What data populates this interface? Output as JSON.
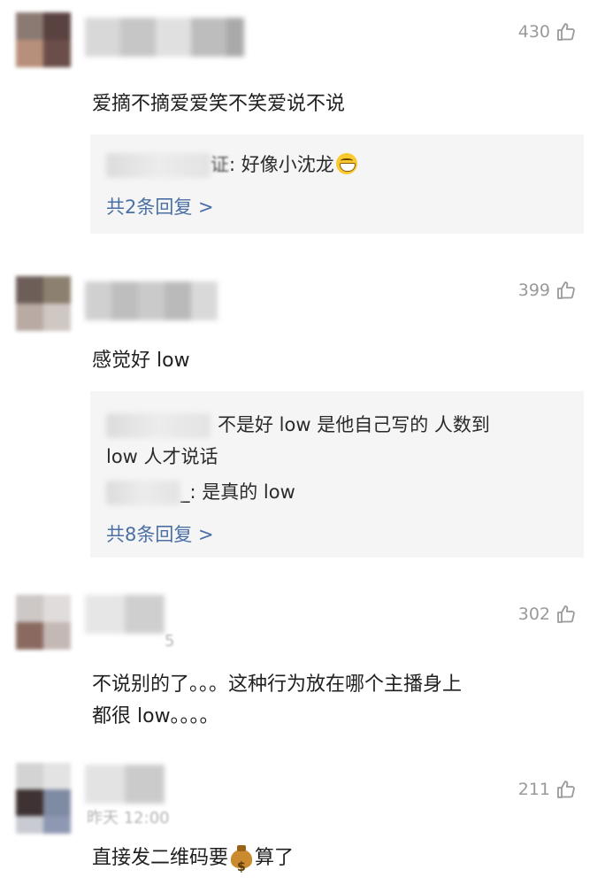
{
  "comments": [
    {
      "likes": "430",
      "text": "爱摘不摘爱爱笑不笑爱说不说",
      "replies": [
        {
          "name_suffix": "证",
          "text": ": 好像小沈龙"
        }
      ],
      "reply_more": "共2条回复 >"
    },
    {
      "likes": "399",
      "text": "感觉好 low",
      "replies": [
        {
          "text": "不是好 low 是他自己写的  人数到"
        },
        {
          "text": "low 人才说话"
        },
        {
          "text": "_: 是真的 low"
        }
      ],
      "reply_more": "共8条回复 >"
    },
    {
      "likes": "302",
      "time": "5",
      "text_lines": [
        "不说别的了。。。这种行为放在哪个主播身上",
        "都很 low。。。。"
      ]
    },
    {
      "likes": "211",
      "time": "昨天 12:00",
      "text_before": "直接发二维码要",
      "text_after": "算了",
      "emoji": "money-bag-icon"
    }
  ],
  "colors": {
    "reply_link": "#4a6fa5",
    "likes": "#9a9a9a",
    "reply_bg": "#f5f5f5"
  }
}
